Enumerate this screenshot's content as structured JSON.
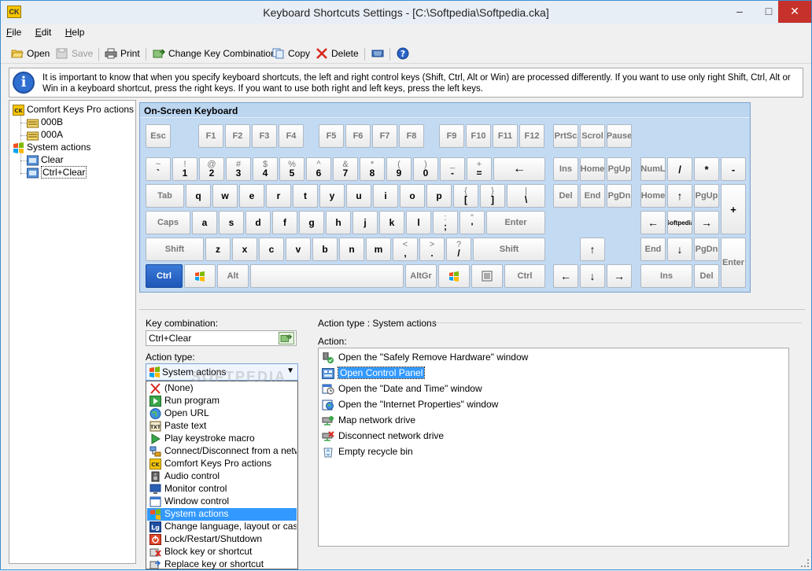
{
  "window": {
    "title": "Keyboard Shortcuts Settings - [C:\\Softpedia\\Softpedia.cka]",
    "app_icon": "CK",
    "controls": {
      "minimize": "–",
      "maximize": "□",
      "close": "✕"
    }
  },
  "menu": [
    {
      "label": "File",
      "underline": "F",
      "rest": "ile"
    },
    {
      "label": "Edit",
      "underline": "E",
      "rest": "dit"
    },
    {
      "label": "Help",
      "underline": "H",
      "rest": "elp"
    }
  ],
  "toolbar": {
    "open": "Open",
    "save": "Save",
    "print": "Print",
    "change_key": "Change Key Combination",
    "copy": "Copy",
    "delete": "Delete"
  },
  "info": {
    "text": "It is important to know that when you specify keyboard shortcuts, the left and right control keys (Shift, Ctrl, Alt or Win) are processed differently. If you want to use only right Shift, Ctrl, Alt or Win in a keyboard shortcut, press the right keys. If you want to use both right and left keys, press the left keys."
  },
  "tree": {
    "root": "Comfort Keys Pro actions",
    "root_children": [
      "000B",
      "000A"
    ],
    "system": "System actions",
    "system_children": [
      "Clear",
      "Ctrl+Clear"
    ]
  },
  "keyboard": {
    "title": "On-Screen Keyboard",
    "function_row": [
      "Esc",
      "F1",
      "F2",
      "F3",
      "F4",
      "F5",
      "F6",
      "F7",
      "F8",
      "F9",
      "F10",
      "F11",
      "F12",
      "PrtSc",
      "Scrol",
      "Pause"
    ],
    "number_row": [
      {
        "top": "~",
        "bottom": "`"
      },
      {
        "top": "!",
        "bottom": "1"
      },
      {
        "top": "@",
        "bottom": "2"
      },
      {
        "top": "#",
        "bottom": "3"
      },
      {
        "top": "$",
        "bottom": "4"
      },
      {
        "top": "%",
        "bottom": "5"
      },
      {
        "top": "^",
        "bottom": "6"
      },
      {
        "top": "&",
        "bottom": "7"
      },
      {
        "top": "*",
        "bottom": "8"
      },
      {
        "top": "(",
        "bottom": "9"
      },
      {
        "top": ")",
        "bottom": "0"
      },
      {
        "top": "_",
        "bottom": "-"
      },
      {
        "top": "+",
        "bottom": "="
      }
    ],
    "backspace": "←",
    "tab": "Tab",
    "row_q": [
      "q",
      "w",
      "e",
      "r",
      "t",
      "y",
      "u",
      "i",
      "o",
      "p"
    ],
    "brackets": [
      {
        "top": "{",
        "bottom": "["
      },
      {
        "top": "}",
        "bottom": "]"
      },
      {
        "top": "|",
        "bottom": "\\"
      }
    ],
    "caps": "Caps",
    "row_a": [
      "a",
      "s",
      "d",
      "f",
      "g",
      "h",
      "j",
      "k",
      "l"
    ],
    "semi": [
      {
        "top": ":",
        "bottom": ";"
      },
      {
        "top": "\"",
        "bottom": "'"
      }
    ],
    "enter": "Enter",
    "shift": "Shift",
    "row_z": [
      "z",
      "x",
      "c",
      "v",
      "b",
      "n",
      "m"
    ],
    "punct": [
      {
        "top": "<",
        "bottom": ","
      },
      {
        "top": ">",
        "bottom": "."
      },
      {
        "top": "?",
        "bottom": "/"
      }
    ],
    "ctrl": "Ctrl",
    "alt": "Alt",
    "altgr": "AltGr",
    "nav": [
      "Ins",
      "Home",
      "PgUp",
      "Del",
      "End",
      "PgDn"
    ],
    "arrows": {
      "up": "↑",
      "left": "←",
      "down": "↓",
      "right": "→"
    },
    "numpad": {
      "num": "NumL",
      "div": "/",
      "mul": "*",
      "minus": "-",
      "home": "Home",
      "up": "↑",
      "pgup": "PgUp",
      "plus": "+",
      "left": "←",
      "center": "Softpedia",
      "right": "→",
      "end": "End",
      "down": "↓",
      "pgdn": "PgDn",
      "enter": "Enter",
      "ins": "Ins",
      "del": "Del"
    }
  },
  "form": {
    "key_combination_label": "Key combination:",
    "key_combination_value": "Ctrl+Clear",
    "action_type_label": "Action type:",
    "action_type_value": "System actions",
    "action_type_options": [
      "(None)",
      "Run program",
      "Open URL",
      "Paste text",
      "Play keystroke macro",
      "Connect/Disconnect from a network",
      "Comfort Keys Pro actions",
      "Audio control",
      "Monitor control",
      "Window control",
      "System actions",
      "Change language, layout or case",
      "Lock/Restart/Shutdown",
      "Block key or shortcut",
      "Replace key or shortcut"
    ],
    "selected_option_index": 10
  },
  "action_panel": {
    "header": "Action type : System actions",
    "action_label": "Action:",
    "actions": [
      "Open the \"Safely Remove Hardware\" window",
      "Open Control Panel",
      "Open the \"Date and Time\" window",
      "Open the \"Internet Properties\" window",
      "Map network drive",
      "Disconnect network drive",
      "Empty recycle bin"
    ],
    "selected_index": 1
  },
  "watermark": "SOFTPEDIA",
  "colors": {
    "accent": "#3399ff",
    "keyboard_bg": "#c3daf3",
    "active_key": "#1f57b8"
  }
}
